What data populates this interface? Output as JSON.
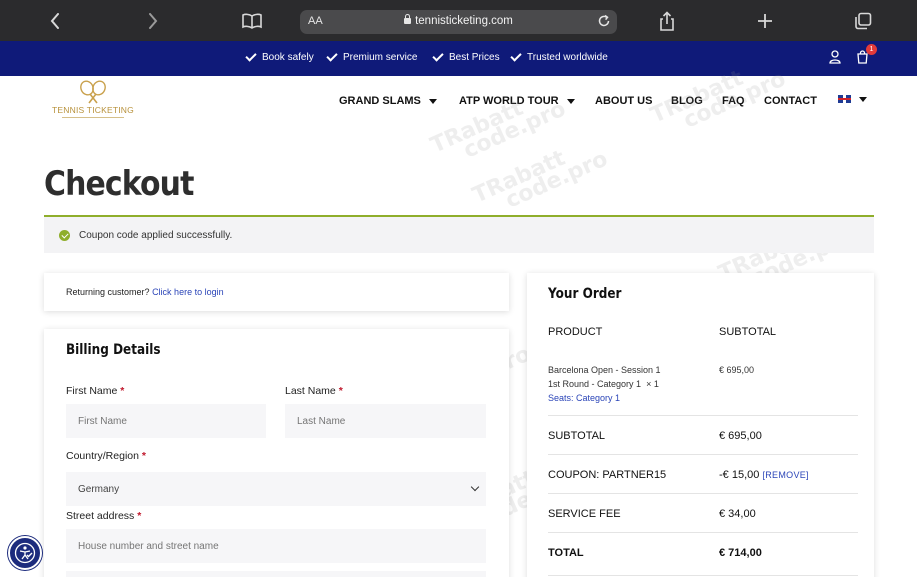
{
  "browser": {
    "url": "tennisticketing.com",
    "text_size_label": "AA",
    "icons": [
      "back-icon",
      "forward-icon",
      "book-icon",
      "lock-icon",
      "reload-icon",
      "share-icon",
      "plus-icon",
      "tabs-icon"
    ]
  },
  "promo": {
    "items": [
      "Book safely",
      "Premium service",
      "Best Prices",
      "Trusted worldwide"
    ],
    "cart_count": "1",
    "background_color": "#0f1a79"
  },
  "header": {
    "logo_text": "TENNIS TICKETING",
    "nav": [
      "GRAND SLAMS",
      "ATP WORLD TOUR",
      "ABOUT US",
      "BLOG",
      "FAQ",
      "CONTACT"
    ],
    "language_flag": "uk-flag-icon"
  },
  "page": {
    "title": "Checkout",
    "notice": "Coupon code applied successfully.",
    "accent_color": "#8fae2b"
  },
  "returning": {
    "prompt": "Returning customer?",
    "link": "Click here to login"
  },
  "billing": {
    "heading": "Billing Details",
    "first_name_label": "First Name",
    "first_name_placeholder": "First Name",
    "last_name_label": "Last Name",
    "last_name_placeholder": "Last Name",
    "country_label": "Country/Region",
    "country_value": "Germany",
    "street_label": "Street address",
    "street_placeholder": "House number and street name",
    "required_mark": "*"
  },
  "order": {
    "heading": "Your Order",
    "col_product": "PRODUCT",
    "col_subtotal": "SUBTOTAL",
    "item_line1": "Barcelona Open - Session 1",
    "item_line2": "1st Round - Category 1",
    "item_qty": "× 1",
    "item_seats": "Seats: Category 1",
    "item_price": "€ 695,00",
    "subtotal_label": "SUBTOTAL",
    "subtotal_value": "€ 695,00",
    "coupon_label": "COUPON: PARTNER15",
    "coupon_value": "-€ 15,00",
    "coupon_remove": "[REMOVE]",
    "fee_label": "SERVICE FEE",
    "fee_value": "€ 34,00",
    "total_label": "TOTAL",
    "total_value": "€ 714,00"
  },
  "watermark": {
    "line1": "TRabatt",
    "line2": "code.pro"
  }
}
